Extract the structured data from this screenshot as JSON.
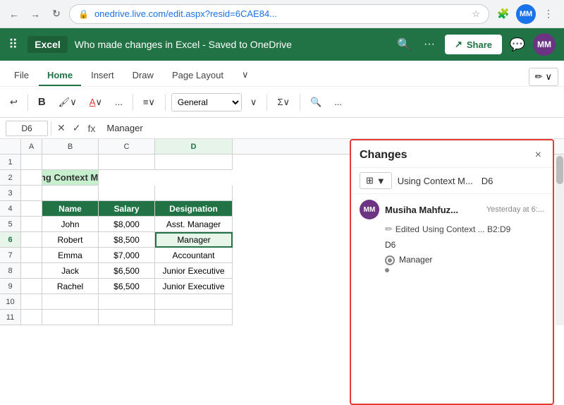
{
  "browser": {
    "url": "onedrive.live.com/edit.aspx?resid=6CAE84...",
    "profile_initials": "MM"
  },
  "excel": {
    "title": "Who made changes in Excel  -  Saved to OneDrive",
    "profile_initials": "MM",
    "share_label": "Share",
    "pencil_edit_label": "✏"
  },
  "ribbon": {
    "tabs": [
      "File",
      "Home",
      "Insert",
      "Draw",
      "Page Layout"
    ],
    "active_tab": "Home",
    "number_format": "General",
    "bold_label": "B",
    "more_label": "..."
  },
  "formula_bar": {
    "cell_ref": "D6",
    "formula": "Manager"
  },
  "spreadsheet": {
    "title": "Using Context Menu",
    "headers": [
      "Name",
      "Salary",
      "Designation"
    ],
    "rows": [
      [
        "John",
        "$8,000",
        "Asst. Manager"
      ],
      [
        "Robert",
        "$8,500",
        "Manager"
      ],
      [
        "Emma",
        "$7,000",
        "Accountant"
      ],
      [
        "Jack",
        "$6,500",
        "Junior Executive"
      ],
      [
        "Rachel",
        "$6,500",
        "Junior Executive"
      ]
    ],
    "selected_cell": "D6",
    "selected_row_label": "6"
  },
  "changes_panel": {
    "title": "Changes",
    "close_label": "×",
    "filter_label": "▼",
    "filter_sheet": "Using Context M...",
    "filter_cell": "D6",
    "user_initials": "MM",
    "user_name": "Musiha Mahfuz...",
    "change_time": "Yesterday at 6:...",
    "edit_label": "Edited",
    "edit_range": "Using Context ... B2:D9",
    "cell_label": "D6",
    "value_label": "Manager",
    "bullet_placeholder": "•"
  }
}
